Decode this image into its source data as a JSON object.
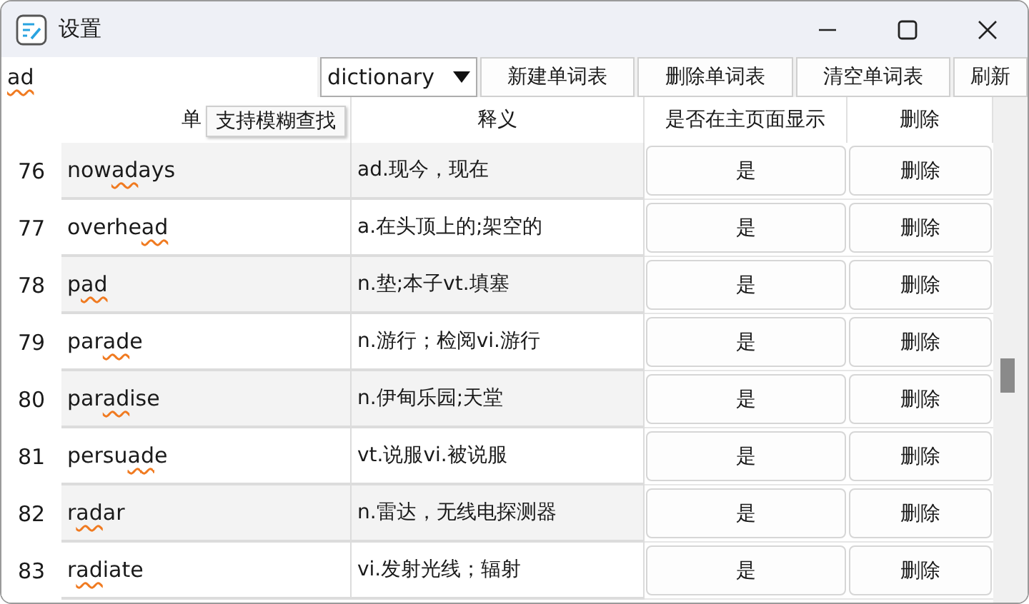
{
  "window": {
    "title": "设置"
  },
  "toolbar": {
    "search": {
      "value": "ad"
    },
    "dictionary": {
      "value": "dictionary"
    },
    "buttons": [
      "新建单词表",
      "删除单词表",
      "清空单词表",
      "刷新"
    ]
  },
  "table": {
    "columns": [
      "单",
      "释义",
      "是否在主页面显示",
      "删除"
    ],
    "tooltip": "支持模糊查找",
    "rows": [
      {
        "index": "76",
        "word_parts": [
          {
            "text": "now",
            "match": false
          },
          {
            "text": "ad",
            "match": true
          },
          {
            "text": "ays",
            "match": false
          }
        ],
        "meaning": "ad.现今，现在",
        "show": "是",
        "delete": "删除",
        "shaded": true
      },
      {
        "index": "77",
        "word_parts": [
          {
            "text": "overhe",
            "match": false
          },
          {
            "text": "ad",
            "match": true
          }
        ],
        "meaning": "a.在头顶上的;架空的",
        "show": "是",
        "delete": "删除",
        "shaded": false
      },
      {
        "index": "78",
        "word_parts": [
          {
            "text": "p",
            "match": false
          },
          {
            "text": "ad",
            "match": true
          }
        ],
        "meaning": "n.垫;本子vt.填塞",
        "show": "是",
        "delete": "删除",
        "shaded": true
      },
      {
        "index": "79",
        "word_parts": [
          {
            "text": "par",
            "match": false
          },
          {
            "text": "ad",
            "match": true
          },
          {
            "text": "e",
            "match": false
          }
        ],
        "meaning": "n.游行；检阅vi.游行",
        "show": "是",
        "delete": "删除",
        "shaded": false
      },
      {
        "index": "80",
        "word_parts": [
          {
            "text": "par",
            "match": false
          },
          {
            "text": "ad",
            "match": true
          },
          {
            "text": "ise",
            "match": false
          }
        ],
        "meaning": "n.伊甸乐园;天堂",
        "show": "是",
        "delete": "删除",
        "shaded": true
      },
      {
        "index": "81",
        "word_parts": [
          {
            "text": "persu",
            "match": false
          },
          {
            "text": "ad",
            "match": true
          },
          {
            "text": "e",
            "match": false
          }
        ],
        "meaning": "vt.说服vi.被说服",
        "show": "是",
        "delete": "删除",
        "shaded": false
      },
      {
        "index": "82",
        "word_parts": [
          {
            "text": "r",
            "match": false
          },
          {
            "text": "ad",
            "match": true
          },
          {
            "text": "ar",
            "match": false
          }
        ],
        "meaning": "n.雷达，无线电探测器",
        "show": "是",
        "delete": "删除",
        "shaded": true
      },
      {
        "index": "83",
        "word_parts": [
          {
            "text": "r",
            "match": false
          },
          {
            "text": "ad",
            "match": true
          },
          {
            "text": "iate",
            "match": false
          }
        ],
        "meaning": "vi.发射光线；辐射",
        "show": "是",
        "delete": "删除",
        "shaded": false
      }
    ]
  }
}
